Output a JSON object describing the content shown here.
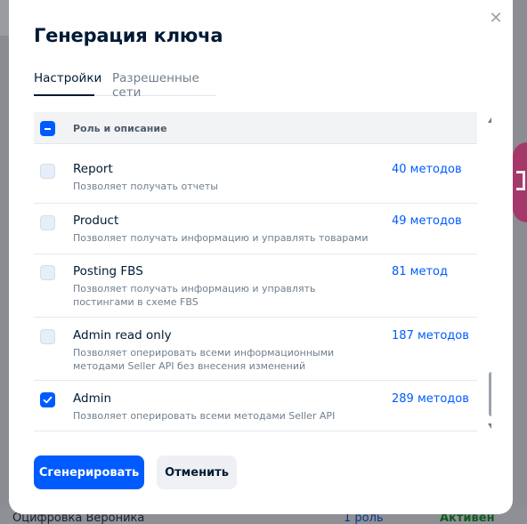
{
  "background": {
    "row": {
      "name": "Оцифровка Вероника",
      "roles": "1 роль",
      "status": "Активен"
    }
  },
  "modal": {
    "title": "Генерация ключа",
    "tabs": [
      {
        "label": "Настройки",
        "active": true
      },
      {
        "label": "Разрешенные сети",
        "active": false
      }
    ],
    "table": {
      "header": {
        "label": "Роль и описание",
        "select_all_state": "indeterminate"
      },
      "rows": [
        {
          "name": "Report",
          "description": "Позволяет получать отчеты",
          "methods": "40 методов",
          "checked": false
        },
        {
          "name": "Product",
          "description": "Позволяет получать информацию и управлять товарами",
          "methods": "49 методов",
          "checked": false
        },
        {
          "name": "Posting FBS",
          "description": "Позволяет получать информацию и управлять постингами в схеме FBS",
          "methods": "81 метод",
          "checked": false
        },
        {
          "name": "Admin read only",
          "description": "Позволяет оперировать всеми информационными методами Seller API без внесения изменений",
          "methods": "187 методов",
          "checked": false
        },
        {
          "name": "Admin",
          "description": "Позволяет оперировать всеми методами Seller API",
          "methods": "289 методов",
          "checked": true
        }
      ]
    },
    "buttons": {
      "generate": "Сгенерировать",
      "cancel": "Отменить"
    }
  },
  "icons": {
    "close": "close-icon",
    "check": "check-icon",
    "scroll_up": "scroll-up-icon",
    "scroll_down": "scroll-down-icon"
  },
  "colors": {
    "accent": "#005bff",
    "text": "#001a34",
    "muted": "#707f8d"
  }
}
